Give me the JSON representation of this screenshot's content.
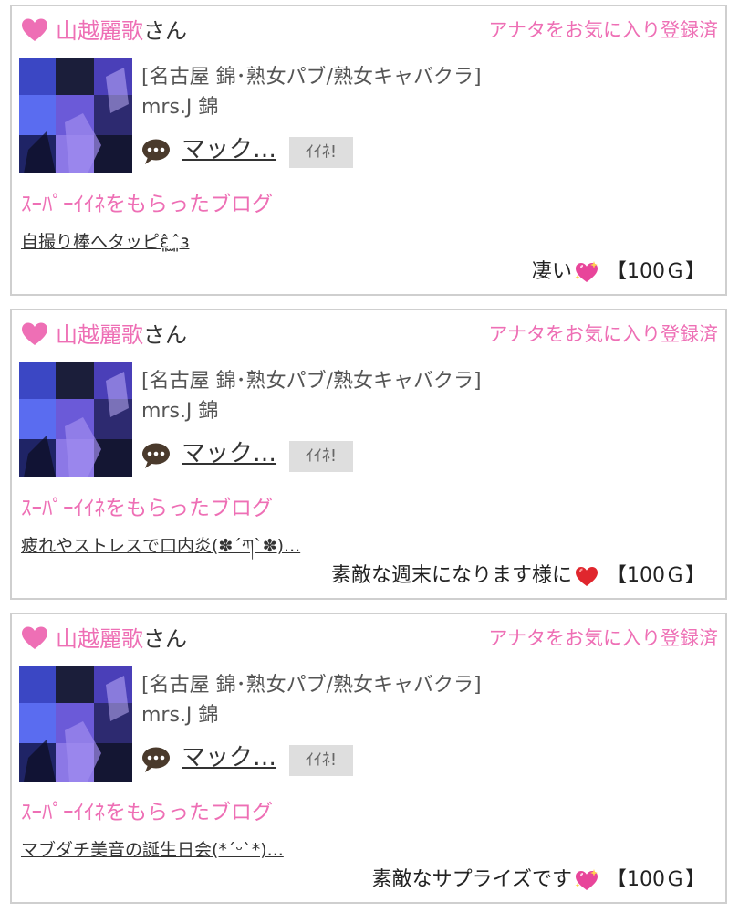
{
  "cards": [
    {
      "name": "山越麗歌",
      "san": "さん",
      "fav": "アナタをお気に入り登録済",
      "shop": "[名古屋 錦･熟女パブ/熟女キャバクラ]",
      "store": "mrs.J 錦",
      "message": "マック…",
      "like": "ｲｲﾈ!",
      "blog_heading": "ｽｰﾊﾟｰｲｲﾈをもらったブログ",
      "blog_title": "自撮り棒へタッピɛ͈̂ ̫ ͈̂ɜ",
      "comment": "凄い",
      "emoji": "sparkling-heart-icon",
      "gift": "【100Ｇ】"
    },
    {
      "name": "山越麗歌",
      "san": "さん",
      "fav": "アナタをお気に入り登録済",
      "shop": "[名古屋 錦･熟女パブ/熟女キャバクラ]",
      "store": "mrs.J 錦",
      "message": "マック…",
      "like": "ｲｲﾈ!",
      "blog_heading": "ｽｰﾊﾟｰｲｲﾈをもらったブログ",
      "blog_title": "疲れやストレスで口内炎(✽´ཀ`✽)...",
      "comment": "素敵な週末になります様に",
      "emoji": "red-heart-icon",
      "gift": "【100Ｇ】"
    },
    {
      "name": "山越麗歌",
      "san": "さん",
      "fav": "アナタをお気に入り登録済",
      "shop": "[名古屋 錦･熟女パブ/熟女キャバクラ]",
      "store": "mrs.J 錦",
      "message": "マック…",
      "like": "ｲｲﾈ!",
      "blog_heading": "ｽｰﾊﾟｰｲｲﾈをもらったブログ",
      "blog_title": "マブダチ美音の誕生日会(*ˊᵕˋ*)...",
      "comment": "素敵なサプライズです",
      "emoji": "sparkling-heart-icon",
      "gift": "【100Ｇ】"
    }
  ],
  "colors": {
    "accent": "#ee6fb5",
    "heart": "#ee6fb5",
    "like_bg": "#dedede",
    "border": "#cfcfcf"
  }
}
